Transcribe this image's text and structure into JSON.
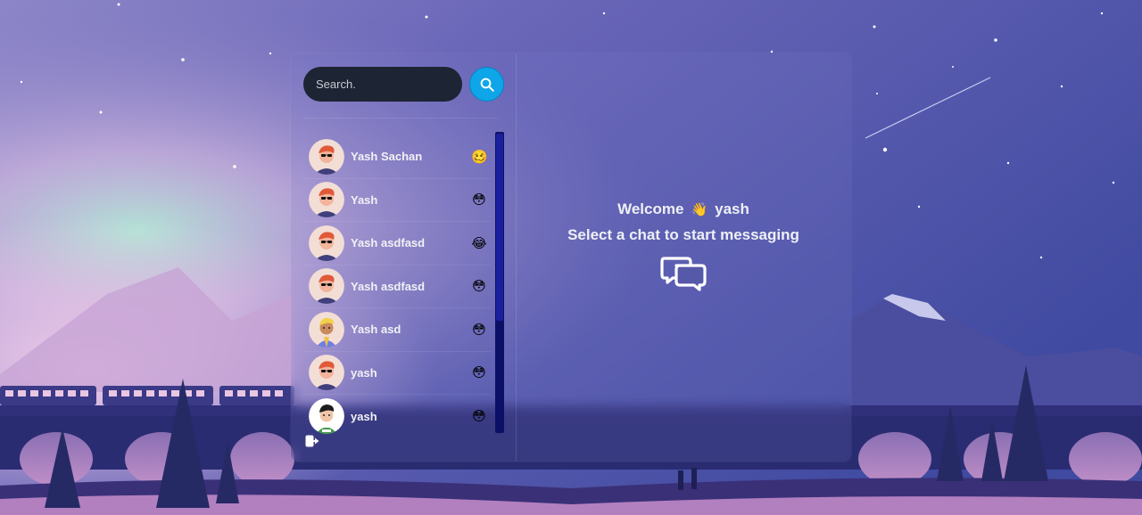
{
  "search": {
    "placeholder": "Search."
  },
  "conversations": [
    {
      "name": "Yash Sachan",
      "emoji": "🥴",
      "avatar": "glasses-red-hair"
    },
    {
      "name": "Yash",
      "emoji": "😳",
      "avatar": "glasses-red-hair"
    },
    {
      "name": "Yash asdfasd",
      "emoji": "😂",
      "avatar": "glasses-red-hair"
    },
    {
      "name": "Yash asdfasd",
      "emoji": "😳",
      "avatar": "glasses-red-hair"
    },
    {
      "name": "Yash asd",
      "emoji": "😳",
      "avatar": "yellow-hair"
    },
    {
      "name": "yash",
      "emoji": "😳",
      "avatar": "glasses-red-hair"
    },
    {
      "name": "yash",
      "emoji": "😳",
      "avatar": "dark-hair-green-shirt"
    }
  ],
  "welcome": {
    "greeting": "Welcome",
    "wave": "👋",
    "username": "yash",
    "subtitle": "Select a chat to start messaging"
  },
  "colors": {
    "accent": "#0ea5e9",
    "search_bg": "#1d2433",
    "scrollbar_track": "#0b1066"
  }
}
